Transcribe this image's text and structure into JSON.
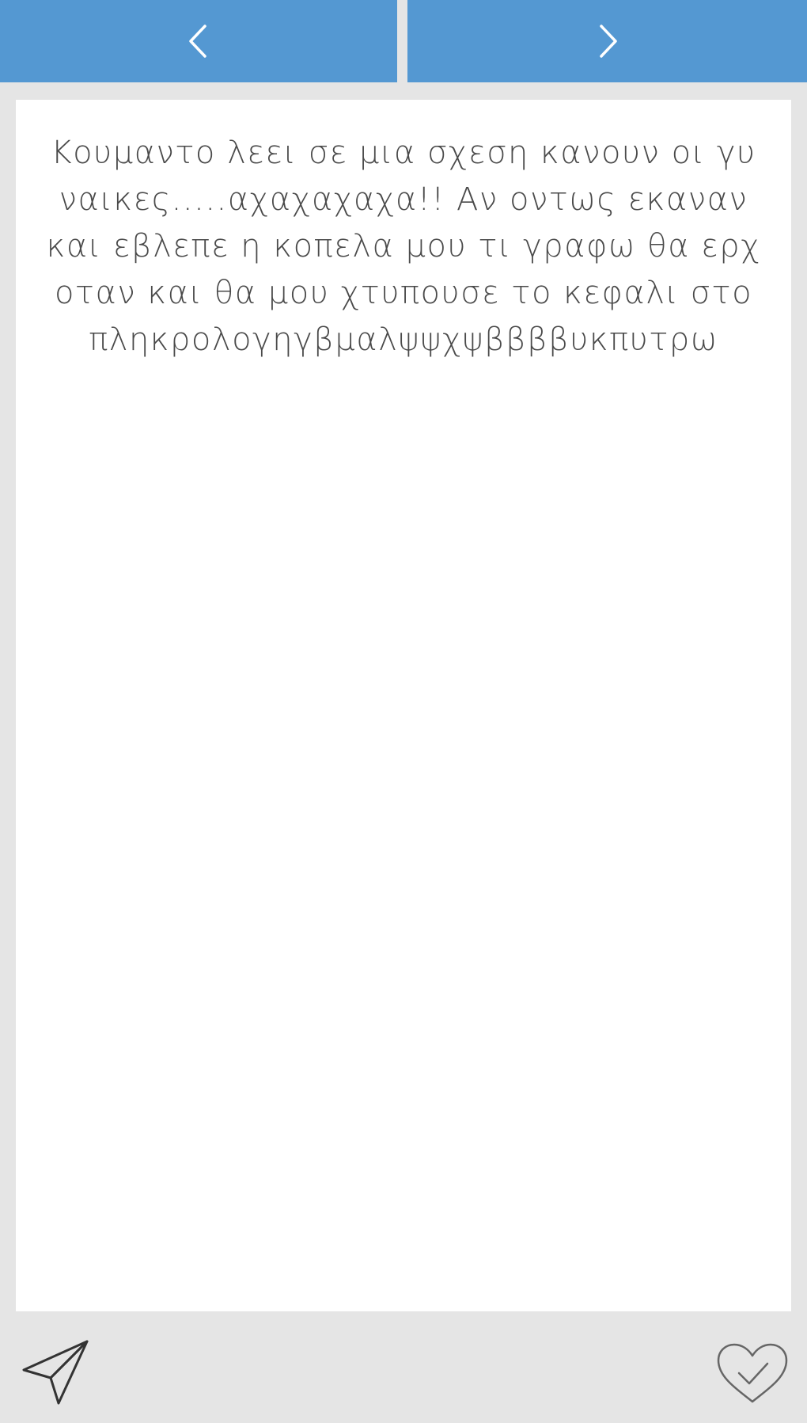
{
  "nav": {
    "prev_icon": "chevron-left-icon",
    "next_icon": "chevron-right-icon",
    "color": "#5498d2"
  },
  "post": {
    "text": "Κουμαντο λεει σε μια σχεση κανουν οι γυναικες.....αχαχαχαχα!! Αν οντως εκαναν και εβλεπε η κοπελα μου τι γραφω θα ερχοταν και θα μου χτυπουσε το κεφαλι στο πληκρολογηγβμαλψψχψββββυκπυτρω"
  },
  "actions": {
    "share_icon": "paper-plane-icon",
    "like_icon": "heart-check-icon"
  }
}
